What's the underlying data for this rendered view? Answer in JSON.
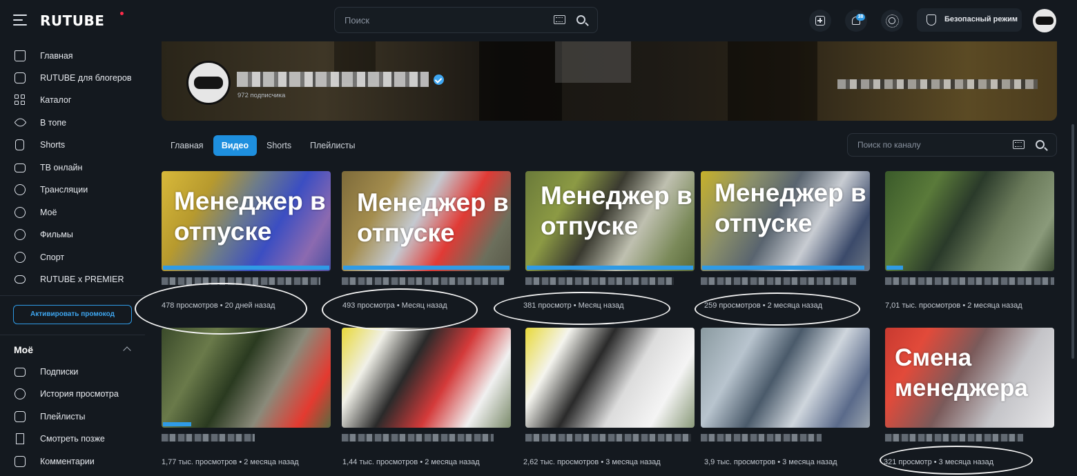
{
  "header": {
    "logo": "RUTUBE",
    "search_placeholder": "Поиск",
    "notification_count": "38",
    "safe_mode_label": "Безопасный режим"
  },
  "sidebar": {
    "items": [
      {
        "label": "Главная",
        "icon": "home-icon"
      },
      {
        "label": "RUTUBE для блогеров",
        "icon": "blogger-icon"
      },
      {
        "label": "Каталог",
        "icon": "grid-icon"
      },
      {
        "label": "В топе",
        "icon": "rocket-icon"
      },
      {
        "label": "Shorts",
        "icon": "shorts-icon"
      },
      {
        "label": "ТВ онлайн",
        "icon": "tv-icon"
      },
      {
        "label": "Трансляции",
        "icon": "broadcast-icon"
      },
      {
        "label": "Моё",
        "icon": "play-circle-icon"
      },
      {
        "label": "Фильмы",
        "icon": "film-icon"
      },
      {
        "label": "Спорт",
        "icon": "ball-icon"
      },
      {
        "label": "RUTUBE x PREMIER",
        "icon": "gamepad-icon"
      }
    ],
    "promo_label": "Активировать промокод",
    "my_section_title": "Моё",
    "my_items": [
      {
        "label": "Подписки",
        "icon": "subscriptions-icon"
      },
      {
        "label": "История просмотра",
        "icon": "history-icon"
      },
      {
        "label": "Плейлисты",
        "icon": "playlist-icon"
      },
      {
        "label": "Смотреть позже",
        "icon": "bookmark-icon"
      },
      {
        "label": "Комментарии",
        "icon": "comment-icon"
      }
    ]
  },
  "channel": {
    "subscribers": "972 подписчика",
    "tabs": [
      "Главная",
      "Видео",
      "Shorts",
      "Плейлисты"
    ],
    "active_tab": "Видео",
    "search_placeholder": "Поиск по каналу"
  },
  "videos": [
    {
      "overlay": "Менеджер в отпуске",
      "meta": "478 просмотров • 20 дней назад",
      "progress": 1.0
    },
    {
      "overlay": "Менеджер в отпуске",
      "meta": "493 просмотра • Месяц назад",
      "progress": 1.0
    },
    {
      "overlay": "Менеджер в отпуске",
      "meta": "381 просмотр • Месяц назад",
      "progress": 1.0
    },
    {
      "overlay": "Менеджер в отпуске",
      "meta": "259 просмотров • 2 месяца назад",
      "progress": 0.96
    },
    {
      "overlay": "",
      "meta": "7,01 тыс. просмотров • 2 месяца назад",
      "progress": 0.1
    },
    {
      "overlay": "",
      "meta": "1,77 тыс. просмотров • 2 месяца назад",
      "progress": 0.17
    },
    {
      "overlay": "",
      "meta": "1,44 тыс. просмотров • 2 месяца назад",
      "progress": 0
    },
    {
      "overlay": "",
      "meta": "2,62 тыс. просмотров • 3 месяца назад",
      "progress": 0
    },
    {
      "overlay": "",
      "meta": "3,9 тыс. просмотров • 3 месяца назад",
      "progress": 0
    },
    {
      "overlay": "Смена менеджера",
      "meta": "321 просмотр • 3 месяца назад",
      "progress": 0
    }
  ]
}
